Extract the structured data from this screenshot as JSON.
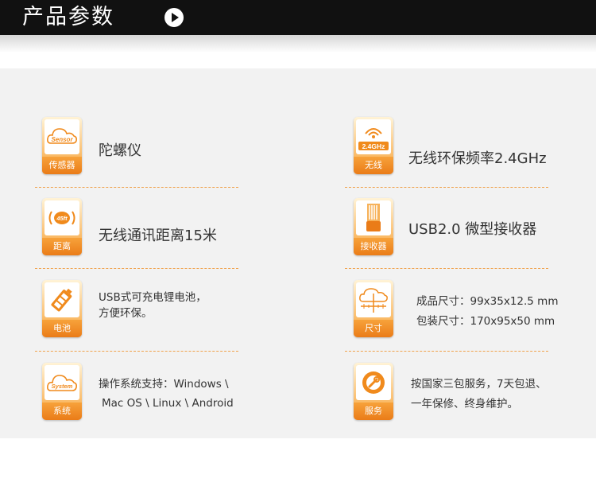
{
  "header": {
    "title": "产品参数"
  },
  "colors": {
    "accent": "#f08a1c",
    "header_bg": "#111111",
    "panel_bg": "#f2f2f2"
  },
  "items": [
    {
      "icon": "sensor-cloud-icon",
      "icon_text": "Sensor",
      "caption": "传感器",
      "lines": [
        "陀螺仪"
      ]
    },
    {
      "icon": "wifi-2.4ghz-icon",
      "icon_text": "2.4GHz",
      "caption": "无线",
      "lines": [
        "无线环保频率2.4GHz"
      ]
    },
    {
      "icon": "distance-45ft-icon",
      "icon_text": "45ft",
      "caption": "距离",
      "lines": [
        "无线通讯距离15米"
      ]
    },
    {
      "icon": "usb-receiver-icon",
      "icon_text": "",
      "caption": "接收器",
      "lines": [
        "USB2.0 微型接收器"
      ]
    },
    {
      "icon": "battery-icon",
      "icon_text": "",
      "caption": "电池",
      "lines": [
        "USB式可充电锂电池，",
        "方便环保。"
      ]
    },
    {
      "icon": "ruler-cloud-icon",
      "icon_text": "",
      "caption": "尺寸",
      "lines": [
        "成品尺寸：99x35x12.5 mm",
        "包装尺寸：170x95x50 mm"
      ]
    },
    {
      "icon": "system-cloud-icon",
      "icon_text": "System",
      "caption": "系统",
      "lines": [
        "操作系统支持：Windows \\",
        "Mac OS \\ Linux \\ Android"
      ]
    },
    {
      "icon": "service-wrench-icon",
      "icon_text": "",
      "caption": "服务",
      "lines": [
        "按国家三包服务，7天包退、",
        "一年保修、终身维护。"
      ]
    }
  ]
}
